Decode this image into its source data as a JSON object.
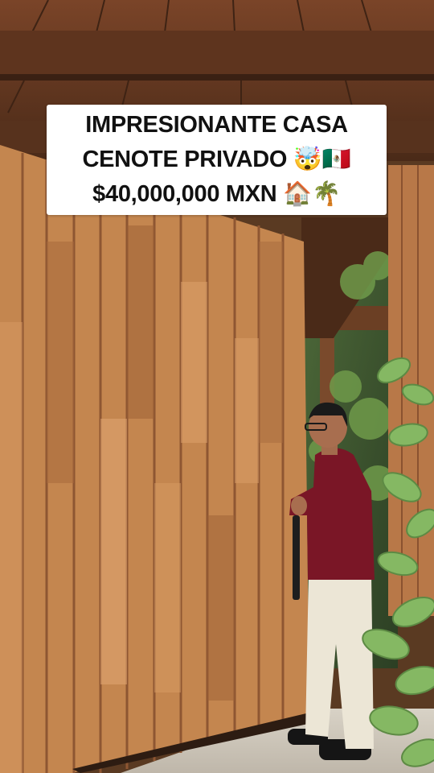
{
  "caption": {
    "line1": "IMPRESIONANTE CASA",
    "line2": "CENOTE PRIVADO 🤯🇲🇽",
    "line3": "$40,000,000 MXN 🏠🌴"
  },
  "scene": {
    "subject": "man in red shirt and white trousers opening a tall wooden pivot door",
    "colors": {
      "wood_light": "#c98a55",
      "wood_dark": "#8a5230",
      "ceiling": "#6b3f24",
      "shirt": "#7a1626",
      "trousers": "#ece6d6",
      "foliage": "#7fb15a"
    }
  }
}
